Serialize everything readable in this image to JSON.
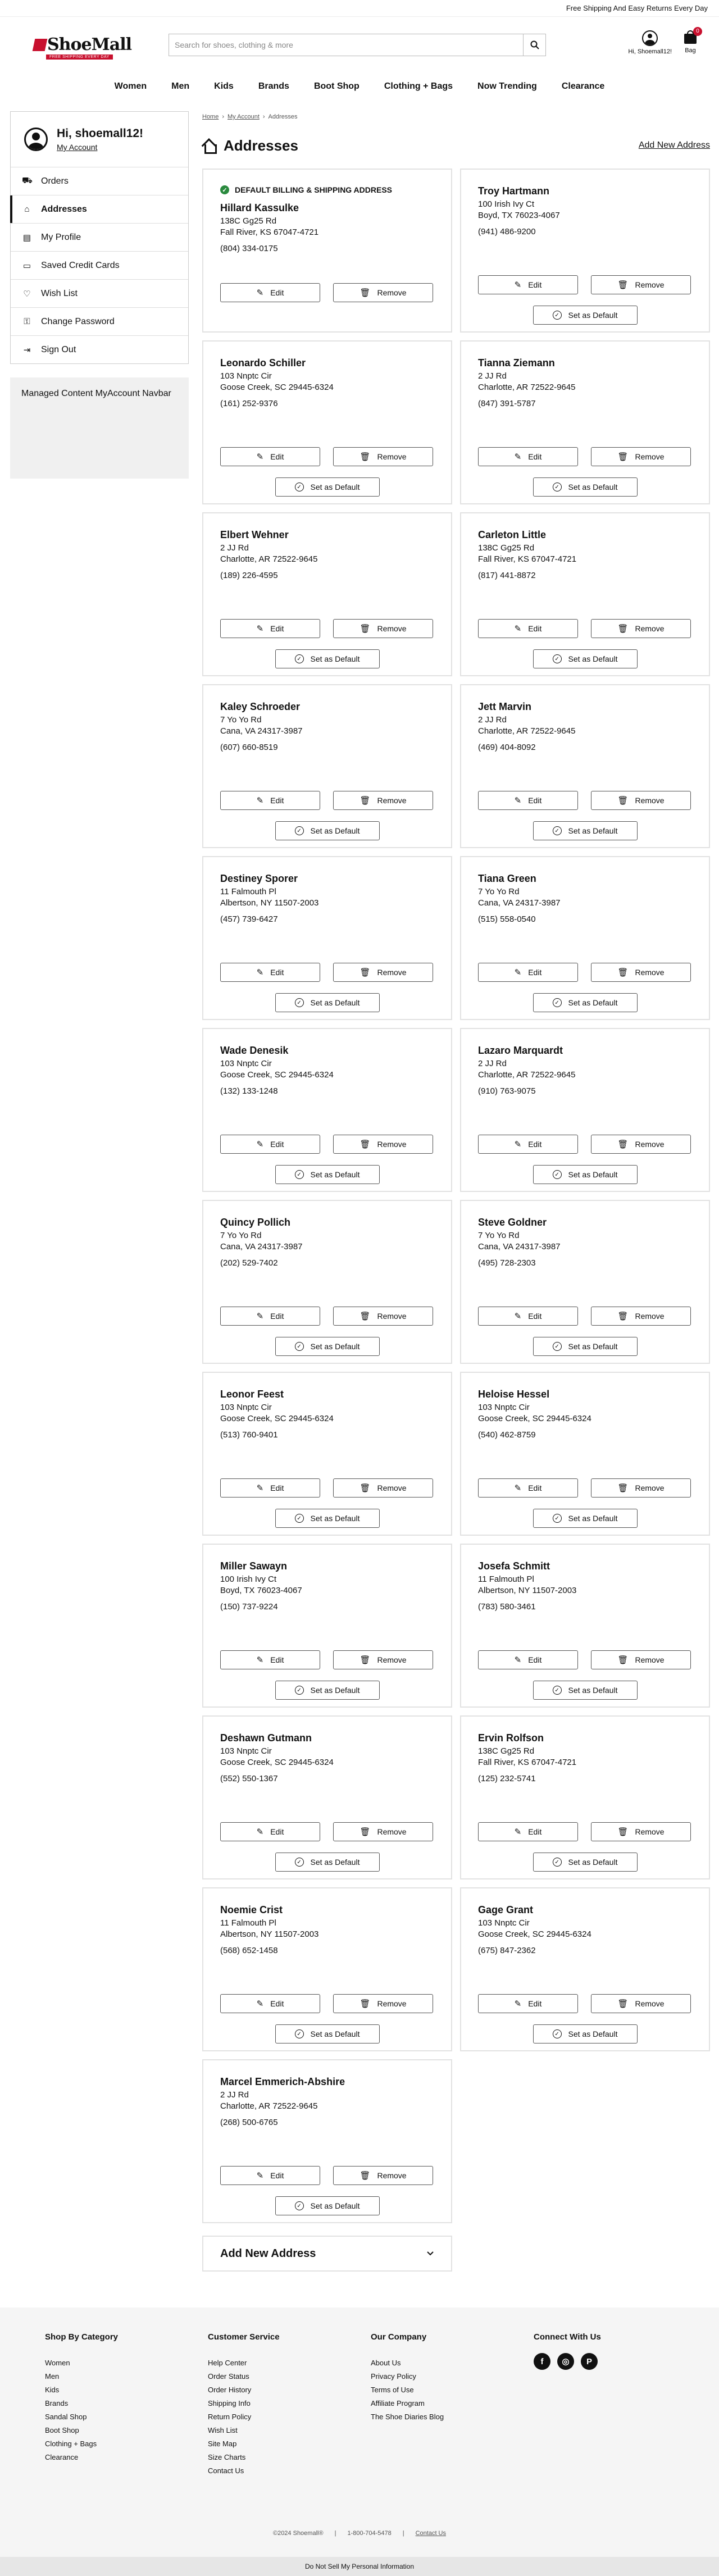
{
  "promo": "Free Shipping And Easy Returns Every Day",
  "brand": {
    "name": "ShoeMall",
    "tagline": "FREE SHIPPING EVERY DAY"
  },
  "search": {
    "placeholder": "Search for shoes, clothing & more"
  },
  "header": {
    "account_label": "Hi, Shoemall12!",
    "bag_label": "Bag",
    "bag_count": "0"
  },
  "nav": [
    "Women",
    "Men",
    "Kids",
    "Brands",
    "Boot Shop",
    "Clothing + Bags",
    "Now Trending",
    "Clearance"
  ],
  "breadcrumb": [
    "Home",
    "My Account",
    "Addresses"
  ],
  "sidebar": {
    "greeting": "Hi, shoemall12!",
    "account_link": "My Account",
    "items": [
      {
        "label": "Orders",
        "icon": "truck-icon"
      },
      {
        "label": "Addresses",
        "icon": "house-icon"
      },
      {
        "label": "My Profile",
        "icon": "profile-icon"
      },
      {
        "label": "Saved Credit Cards",
        "icon": "credit-card-icon"
      },
      {
        "label": "Wish List",
        "icon": "heart-icon"
      },
      {
        "label": "Change Password",
        "icon": "key-icon"
      },
      {
        "label": "Sign Out",
        "icon": "sign-out-icon"
      }
    ],
    "managed": "Managed Content MyAccount Navbar"
  },
  "main": {
    "title": "Addresses",
    "add_link": "Add New Address",
    "default_tag": "DEFAULT BILLING & SHIPPING ADDRESS",
    "edit_label": "Edit",
    "remove_label": "Remove",
    "set_default_label": "Set as Default",
    "add_accordion": "Add New Address"
  },
  "addresses": [
    {
      "name": "Hillard Kassulke",
      "street": "138C Gg25 Rd",
      "city": "Fall River, KS 67047-4721",
      "phone": "(804) 334-0175",
      "is_default": true
    },
    {
      "name": "Troy Hartmann",
      "street": "100 Irish Ivy Ct",
      "city": "Boyd, TX 76023-4067",
      "phone": "(941) 486-9200"
    },
    {
      "name": "Leonardo Schiller",
      "street": "103 Nnptc Cir",
      "city": "Goose Creek, SC 29445-6324",
      "phone": "(161) 252-9376"
    },
    {
      "name": "Tianna Ziemann",
      "street": "2 JJ Rd",
      "city": "Charlotte, AR 72522-9645",
      "phone": "(847) 391-5787"
    },
    {
      "name": "Elbert Wehner",
      "street": "2 JJ Rd",
      "city": "Charlotte, AR 72522-9645",
      "phone": "(189) 226-4595"
    },
    {
      "name": "Carleton Little",
      "street": "138C Gg25 Rd",
      "city": "Fall River, KS 67047-4721",
      "phone": "(817) 441-8872"
    },
    {
      "name": "Kaley Schroeder",
      "street": "7 Yo Yo Rd",
      "city": "Cana, VA 24317-3987",
      "phone": "(607) 660-8519"
    },
    {
      "name": "Jett Marvin",
      "street": "2 JJ Rd",
      "city": "Charlotte, AR 72522-9645",
      "phone": "(469) 404-8092"
    },
    {
      "name": "Destiney Sporer",
      "street": "11 Falmouth Pl",
      "city": "Albertson, NY 11507-2003",
      "phone": "(457) 739-6427"
    },
    {
      "name": "Tiana Green",
      "street": "7 Yo Yo Rd",
      "city": "Cana, VA 24317-3987",
      "phone": "(515) 558-0540"
    },
    {
      "name": "Wade Denesik",
      "street": "103 Nnptc Cir",
      "city": "Goose Creek, SC 29445-6324",
      "phone": "(132) 133-1248"
    },
    {
      "name": "Lazaro Marquardt",
      "street": "2 JJ Rd",
      "city": "Charlotte, AR 72522-9645",
      "phone": "(910) 763-9075"
    },
    {
      "name": "Quincy Pollich",
      "street": "7 Yo Yo Rd",
      "city": "Cana, VA 24317-3987",
      "phone": "(202) 529-7402"
    },
    {
      "name": "Steve Goldner",
      "street": "7 Yo Yo Rd",
      "city": "Cana, VA 24317-3987",
      "phone": "(495) 728-2303"
    },
    {
      "name": "Leonor Feest",
      "street": "103 Nnptc Cir",
      "city": "Goose Creek, SC 29445-6324",
      "phone": "(513) 760-9401"
    },
    {
      "name": "Heloise Hessel",
      "street": "103 Nnptc Cir",
      "city": "Goose Creek, SC 29445-6324",
      "phone": "(540) 462-8759"
    },
    {
      "name": "Miller Sawayn",
      "street": "100 Irish Ivy Ct",
      "city": "Boyd, TX 76023-4067",
      "phone": "(150) 737-9224"
    },
    {
      "name": "Josefa Schmitt",
      "street": "11 Falmouth Pl",
      "city": "Albertson, NY 11507-2003",
      "phone": "(783) 580-3461"
    },
    {
      "name": "Deshawn Gutmann",
      "street": "103 Nnptc Cir",
      "city": "Goose Creek, SC 29445-6324",
      "phone": "(552) 550-1367"
    },
    {
      "name": "Ervin Rolfson",
      "street": "138C Gg25 Rd",
      "city": "Fall River, KS 67047-4721",
      "phone": "(125) 232-5741"
    },
    {
      "name": "Noemie Crist",
      "street": "11 Falmouth Pl",
      "city": "Albertson, NY 11507-2003",
      "phone": "(568) 652-1458"
    },
    {
      "name": "Gage Grant",
      "street": "103 Nnptc Cir",
      "city": "Goose Creek, SC 29445-6324",
      "phone": "(675) 847-2362"
    },
    {
      "name": "Marcel Emmerich-Abshire",
      "street": "2 JJ Rd",
      "city": "Charlotte, AR 72522-9645",
      "phone": "(268) 500-6765"
    }
  ],
  "footer": {
    "columns": [
      {
        "title": "Shop By Category",
        "links": [
          "Women",
          "Men",
          "Kids",
          "Brands",
          "Sandal Shop",
          "Boot Shop",
          "Clothing + Bags",
          "Clearance"
        ]
      },
      {
        "title": "Customer Service",
        "links": [
          "Help Center",
          "Order Status",
          "Order History",
          "Shipping Info",
          "Return Policy",
          "Wish List",
          "Site Map",
          "Size Charts",
          "Contact Us"
        ]
      },
      {
        "title": "Our Company",
        "links": [
          "About Us",
          "Privacy Policy",
          "Terms of Use",
          "Affiliate Program",
          "The Shoe Diaries Blog"
        ]
      }
    ],
    "connect_title": "Connect With Us",
    "social": [
      {
        "icon": "facebook-icon",
        "glyph": "f"
      },
      {
        "icon": "instagram-icon",
        "glyph": "◎"
      },
      {
        "icon": "pinterest-icon",
        "glyph": "P"
      }
    ],
    "copyright": "©2024 Shoemall®",
    "phone": "1-800-704-5478",
    "contact": "Contact Us",
    "dnsl": "Do Not Sell My Personal Information"
  }
}
